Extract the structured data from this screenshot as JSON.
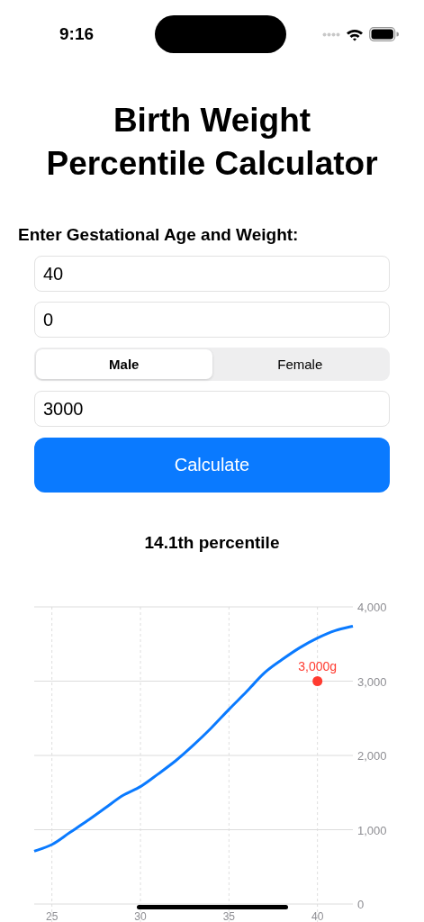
{
  "status_bar": {
    "time": "9:16"
  },
  "title": "Birth Weight Percentile Calculator",
  "form": {
    "label": "Enter Gestational Age and Weight:",
    "fields": [
      {
        "value": "40"
      },
      {
        "value": "0"
      }
    ],
    "sex": [
      {
        "label": "Male",
        "selected": true
      },
      {
        "label": "Female",
        "selected": false
      }
    ],
    "weight": {
      "value": "3000"
    },
    "button": "Calculate"
  },
  "result": "14.1th percentile",
  "chart": {
    "chart_data": {
      "type": "line",
      "x": [
        24,
        25,
        26,
        27,
        28,
        29,
        30,
        31,
        32,
        33,
        34,
        35,
        36,
        37,
        38,
        39,
        40,
        41,
        42
      ],
      "series": [
        {
          "color": "#0a7aff",
          "values": [
            710,
            800,
            960,
            1120,
            1290,
            1460,
            1580,
            1750,
            1930,
            2140,
            2370,
            2620,
            2860,
            3110,
            3290,
            3450,
            3580,
            3680,
            3740
          ]
        }
      ],
      "xlim": [
        24,
        42
      ],
      "ylim": [
        0,
        4000
      ],
      "xticks": [
        25,
        30,
        35,
        40
      ],
      "yticks": [
        {
          "value": 0,
          "label": "0"
        },
        {
          "value": 1000,
          "label": "1,000"
        },
        {
          "value": 2000,
          "label": "2,000"
        },
        {
          "value": 3000,
          "label": "3,000"
        },
        {
          "value": 4000,
          "label": "4,000"
        }
      ],
      "grid": true,
      "annotations": [
        {
          "x": 40,
          "y": 3000,
          "text": "3,000g"
        }
      ]
    }
  }
}
